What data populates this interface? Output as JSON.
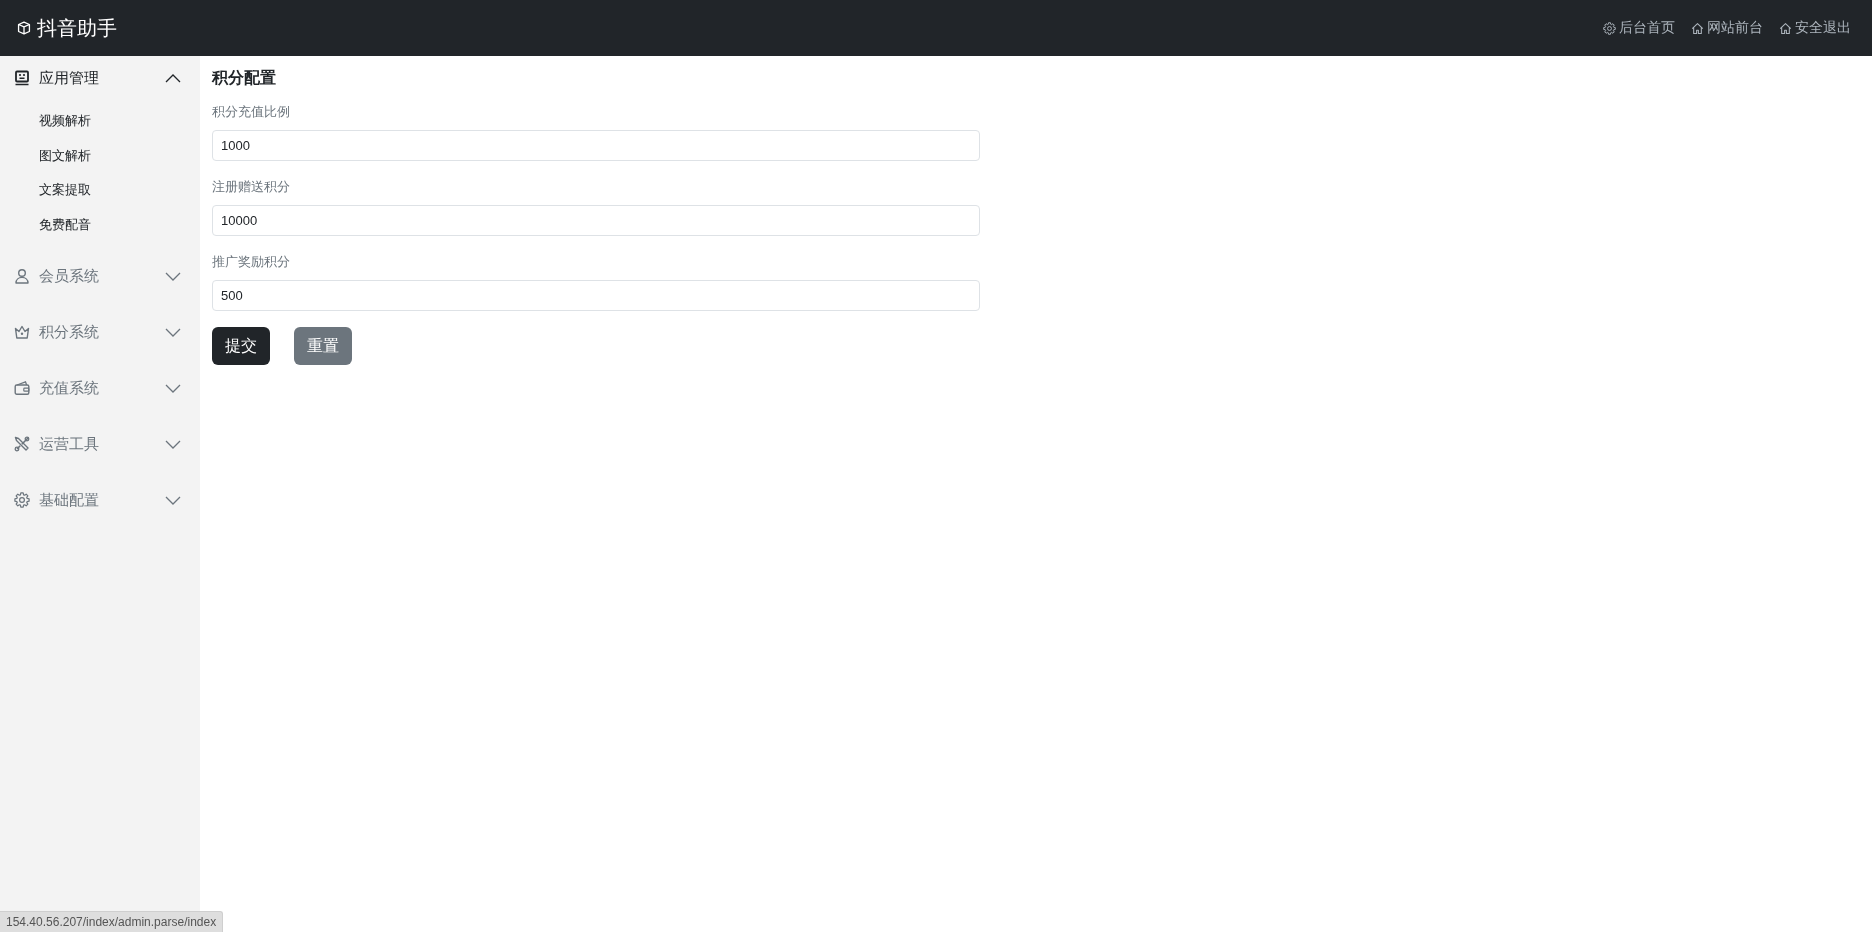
{
  "header": {
    "title": "抖音助手",
    "links": [
      {
        "label": "后台首页"
      },
      {
        "label": "网站前台"
      },
      {
        "label": "安全退出"
      }
    ]
  },
  "sidebar": {
    "items": [
      {
        "label": "应用管理",
        "expanded": true,
        "children": [
          {
            "label": "视频解析"
          },
          {
            "label": "图文解析"
          },
          {
            "label": "文案提取"
          },
          {
            "label": "免费配音"
          }
        ]
      },
      {
        "label": "会员系统",
        "expanded": false
      },
      {
        "label": "积分系统",
        "expanded": false
      },
      {
        "label": "充值系统",
        "expanded": false
      },
      {
        "label": "运营工具",
        "expanded": false
      },
      {
        "label": "基础配置",
        "expanded": false
      }
    ]
  },
  "form": {
    "title": "积分配置",
    "fields": [
      {
        "label": "积分充值比例",
        "value": "1000"
      },
      {
        "label": "注册赠送积分",
        "value": "10000"
      },
      {
        "label": "推广奖励积分",
        "value": "500"
      }
    ],
    "buttons": [
      {
        "label": "提交",
        "kind": "submit"
      },
      {
        "label": "重置",
        "kind": "reset"
      }
    ]
  },
  "status_bar": {
    "url": "154.40.56.207/index/admin.parse/index"
  }
}
